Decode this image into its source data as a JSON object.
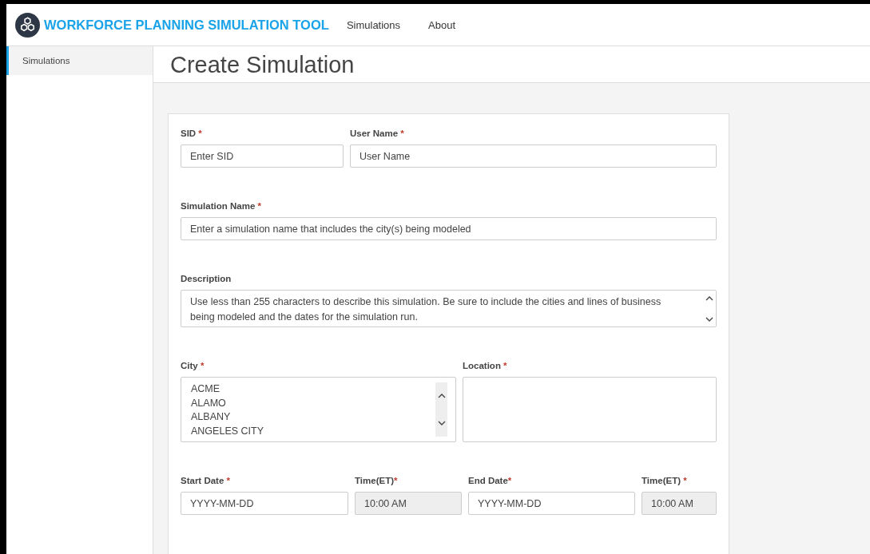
{
  "header": {
    "title": "WORKFORCE PLANNING SIMULATION TOOL",
    "nav": [
      {
        "label": "Simulations"
      },
      {
        "label": "About"
      }
    ]
  },
  "sidebar": {
    "items": [
      {
        "label": "Simulations",
        "selected": true
      }
    ]
  },
  "page_title": "Create Simulation",
  "form": {
    "rows": [
      {
        "fields": [
          {
            "kind": "text",
            "label": "SID",
            "mark": " *",
            "placeholder": "Enter SID",
            "disabled": false
          },
          {
            "kind": "text",
            "label": "User Name",
            "mark": " *",
            "placeholder": "User Name",
            "disabled": false
          }
        ]
      },
      {
        "fields": [
          {
            "kind": "text",
            "label": "Simulation Name",
            "mark": " *",
            "placeholder": "Enter a simulation name that includes the city(s) being modeled",
            "disabled": false
          }
        ]
      },
      {
        "fields": [
          {
            "kind": "textarea",
            "label": "Description",
            "placeholder": "Use less than 255 characters to describe this simulation. Be sure to include the cities and lines of business being modeled and the dates for the simulation run.",
            "disabled": false
          }
        ]
      },
      {
        "fields": [
          {
            "kind": "list",
            "label": "City",
            "mark": " *",
            "options": [
              "ACME",
              "ALAMO",
              "ALBANY",
              "ANGELES CITY"
            ],
            "disabled": false
          },
          {
            "kind": "list",
            "label": "Location",
            "mark": " *",
            "disabled": false
          }
        ]
      },
      {
        "fields": [
          {
            "kind": "text",
            "label": "Start Date",
            "mark": " *",
            "placeholder": "YYYY-MM-DD",
            "disabled": false
          },
          {
            "kind": "text",
            "label": "Time(ET)",
            "mark": "*",
            "value": "10:00 AM",
            "disabled": true
          },
          {
            "kind": "text",
            "label": "End Date",
            "mark": "*",
            "placeholder": "YYYY-MM-DD",
            "disabled": false
          },
          {
            "kind": "text",
            "label": "Time(ET)",
            "mark": " *",
            "value": "10:00 AM",
            "disabled": true
          }
        ]
      }
    ]
  }
}
